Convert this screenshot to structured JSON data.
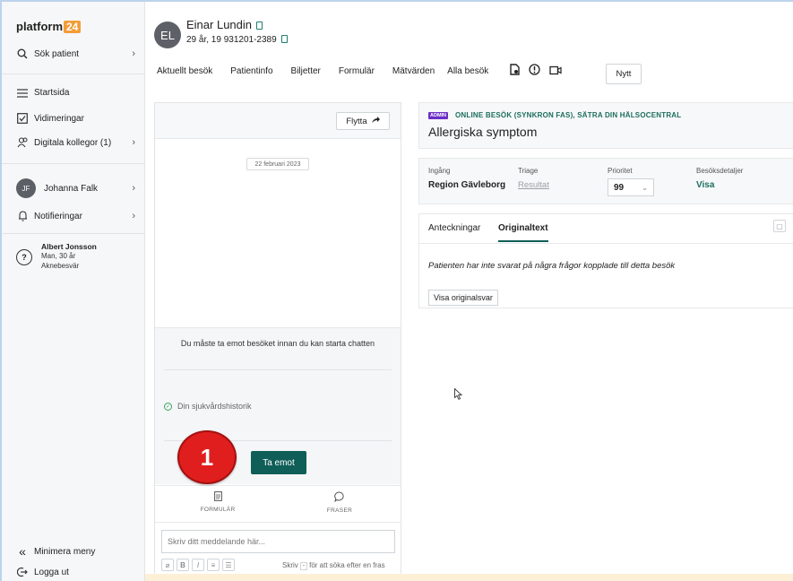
{
  "sidebar": {
    "logo_text": "platform",
    "logo_num": "24",
    "search_label": "Sök patient",
    "items": [
      {
        "label": "Startsida",
        "icon": "list-icon"
      },
      {
        "label": "Vidimeringar",
        "icon": "checkbox-icon"
      },
      {
        "label": "Digitala kollegor (1)",
        "icon": "users-icon"
      }
    ],
    "user": {
      "initials": "JF",
      "name": "Johanna Falk"
    },
    "notifications_label": "Notifieringar",
    "patient_card": {
      "name": "Albert Jonsson",
      "info": "Man, 30 år",
      "reason": "Aknebesvär"
    },
    "minimize_label": "Minimera meny",
    "logout_label": "Logga ut"
  },
  "header": {
    "initials": "EL",
    "patient_name": "Einar Lundin",
    "patient_sub": "29 år, 19 931201-2389"
  },
  "nav": {
    "tabs": [
      "Aktuellt besök",
      "Patientinfo",
      "Biljetter",
      "Formulär",
      "Mätvärden",
      "Alla besök"
    ],
    "new_label": "Nytt"
  },
  "chat": {
    "move_label": "Flytta",
    "date": "22 februari 2023",
    "accept_message": "Du måste ta emot besöket innan du kan starta chatten",
    "history_label": "Din sjukvårdshistorik",
    "accept_button": "Ta emot",
    "step_badge": "1",
    "tool_form": "FORMULÄR",
    "tool_phrases": "FRASER",
    "input_placeholder": "Skriv ditt meddelande här...",
    "hint_prefix": "Skriv",
    "hint_key": "-",
    "hint_suffix": "för att söka efter en fras"
  },
  "visit": {
    "tag": "ADMIN",
    "meta": "ONLINE BESÖK (SYNKRON FAS), SÄTRA DIN HÄLSOCENTRAL",
    "title": "Allergiska symptom"
  },
  "info": {
    "ingang_label": "Ingång",
    "ingang_value": "Region Gävleborg",
    "triage_label": "Triage",
    "triage_value": "Resultat",
    "prio_label": "Prioritet",
    "prio_value": "99",
    "details_label": "Besöksdetaljer",
    "details_value": "Visa"
  },
  "notes": {
    "tab1": "Anteckningar",
    "tab2": "Originaltext",
    "message": "Patienten har inte svarat på några frågor kopplade till detta besök",
    "show_button": "Visa originalsvar"
  },
  "colors": {
    "brand": "#f39c36",
    "primary": "#0f5e58",
    "badge": "#e01e1e",
    "admin": "#6a2fc7"
  }
}
